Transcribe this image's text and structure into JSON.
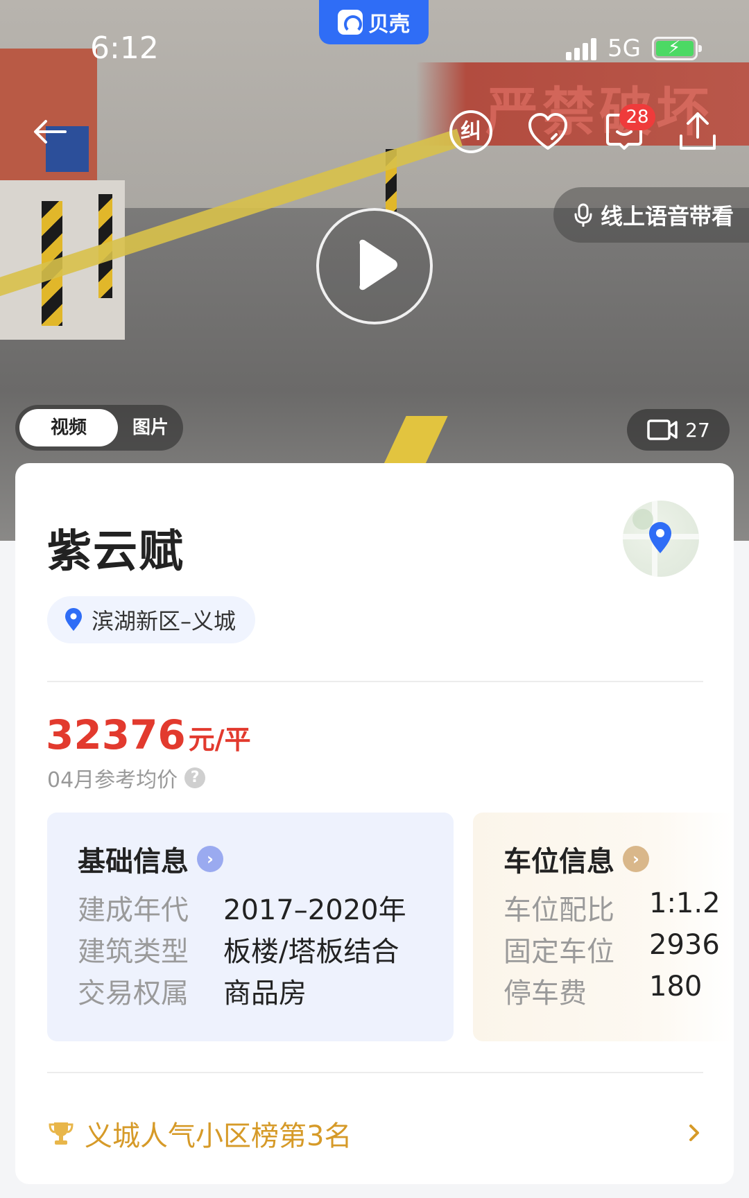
{
  "status_bar": {
    "time": "6:12",
    "network": "5G",
    "app_name": "贝壳",
    "battery_level": 1.0
  },
  "hero": {
    "wall_text": "严禁破坏",
    "voice_tour_label": "线上语音带看",
    "media_tabs": [
      {
        "label": "视频",
        "active": true
      },
      {
        "label": "图片",
        "active": false
      }
    ],
    "media_count": "27"
  },
  "top_nav": {
    "correct_icon_char": "纠",
    "message_badge": "28",
    "icons": [
      "back-arrow-icon",
      "correction-icon",
      "heart-icon",
      "message-icon",
      "share-icon"
    ]
  },
  "community": {
    "name": "紫云赋",
    "location": "滨湖新区–义城",
    "price": "32376",
    "price_unit": "元/平",
    "price_note": "04月参考均价",
    "help_char": "?"
  },
  "basic_info": {
    "title": "基础信息",
    "rows": [
      {
        "key": "建成年代",
        "value": "2017–2020年"
      },
      {
        "key": "建筑类型",
        "value": "板楼/塔板结合"
      },
      {
        "key": "交易权属",
        "value": "商品房"
      }
    ]
  },
  "parking_info": {
    "title": "车位信息",
    "rows": [
      {
        "key": "车位配比",
        "value": "1:1.2"
      },
      {
        "key": "固定车位",
        "value": "2936"
      },
      {
        "key": "停车费",
        "value": "180"
      }
    ]
  },
  "ranking": {
    "text": "义城人气小区榜第3名"
  },
  "colors": {
    "brand_blue": "#2f6df6",
    "price_red": "#e23a2e",
    "rank_gold": "#d69a28",
    "badge_red": "#ef3b3b"
  }
}
